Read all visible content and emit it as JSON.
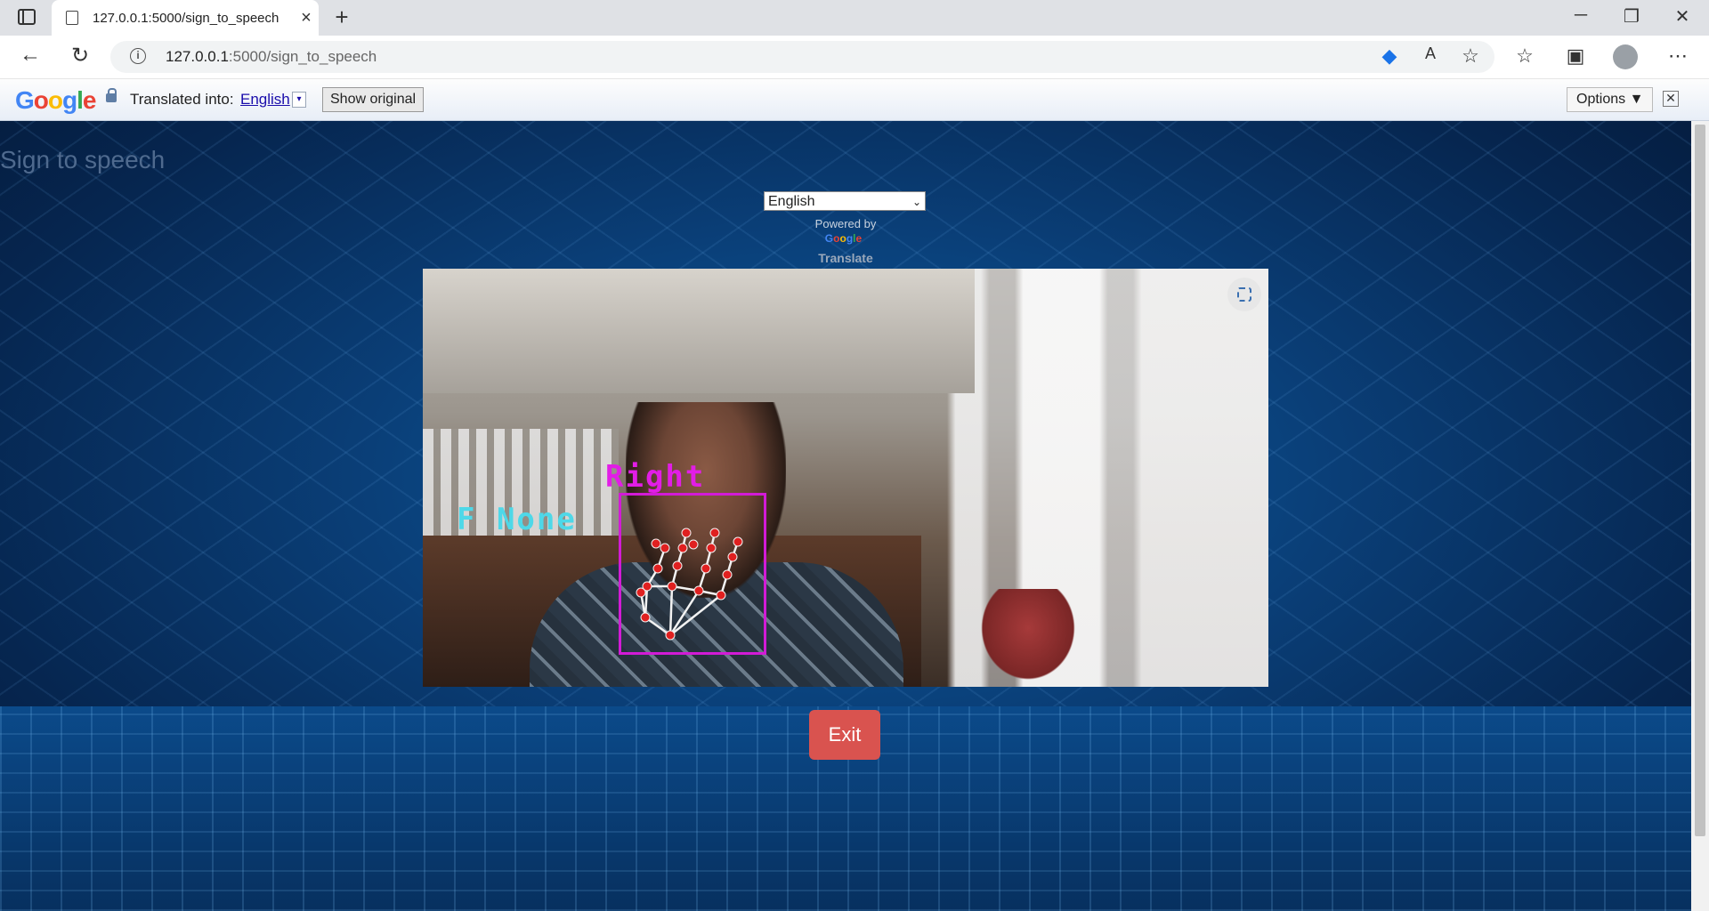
{
  "browser": {
    "tab_title": "127.0.0.1:5000/sign_to_speech",
    "url_host": "127.0.0.1",
    "url_path": ":5000/sign_to_speech",
    "new_tab": "+",
    "close_tab": "×",
    "minimize": "─",
    "restore": "❐",
    "close_window": "✕"
  },
  "translate_bar": {
    "logo": "Google",
    "translated_into": "Translated into:",
    "language": "English",
    "dropdown": "▾",
    "show_original": "Show original",
    "options": "Options ▼",
    "close": "✕"
  },
  "page": {
    "title": "Sign to speech",
    "language_select": "English",
    "powered_by": "Powered by",
    "google_small": "Google",
    "translate": "Translate",
    "exit_button": "Exit"
  },
  "camera": {
    "label_hand": "Right",
    "label_prediction": "F None"
  },
  "colors": {
    "exit": "#d9534f",
    "hand_box": "#d21bd6",
    "prediction_text": "#4ed8e8"
  }
}
